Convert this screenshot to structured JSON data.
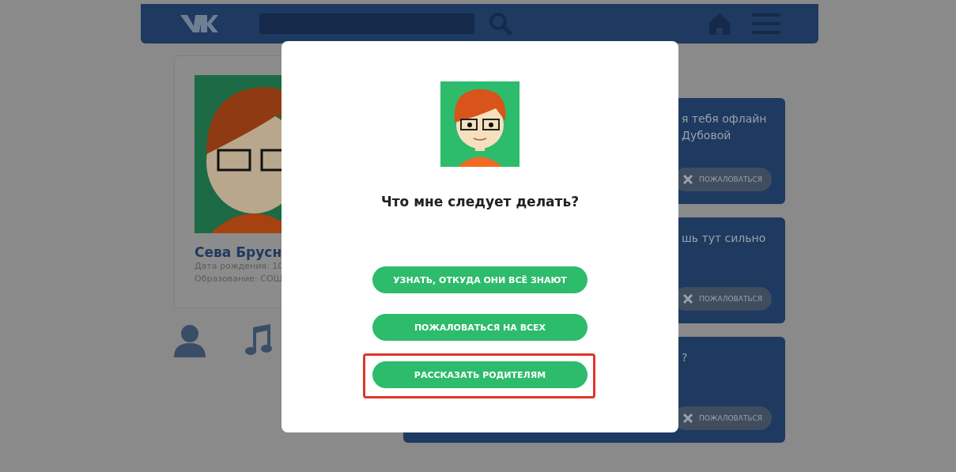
{
  "profile": {
    "name": "Сева Брусн",
    "details": [
      "Дата рождения: 10",
      "Образование: СОШ"
    ]
  },
  "posts": [
    {
      "lines": [
        "я тебя офлайн",
        "Дубовой"
      ],
      "report": "ПОЖАЛОВАТЬСЯ"
    },
    {
      "lines": [
        "шь тут сильно"
      ],
      "report": "ПОЖАЛОВАТЬСЯ"
    },
    {
      "lines": [
        "?"
      ],
      "report": "ПОЖАЛОВАТЬСЯ"
    }
  ],
  "dialog": {
    "title": "Что мне следует делать?",
    "buttons": [
      {
        "label": "УЗНАТЬ, ОТКУДА ОНИ ВСЁ ЗНАЮТ",
        "highlighted": false
      },
      {
        "label": "ПОЖАЛОВАТЬСЯ НА ВСЕХ",
        "highlighted": false
      },
      {
        "label": "РАССКАЗАТЬ РОДИТЕЛЯМ",
        "highlighted": true
      }
    ]
  }
}
